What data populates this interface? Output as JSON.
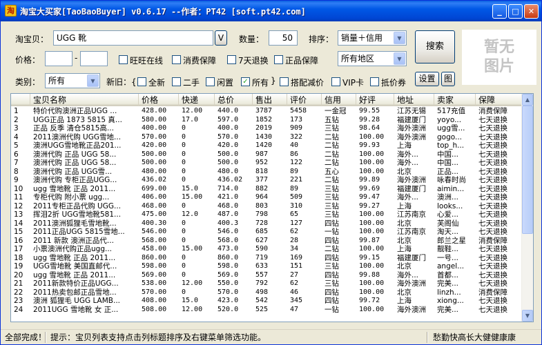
{
  "window": {
    "title": "淘宝大买家[TaoBaoBuyer] v0.6.17 --作者：PT42 [soft.pt42.com]",
    "app_icon": "淘",
    "minimize": "_",
    "maximize": "□",
    "close": "✕"
  },
  "search": {
    "keyword_label": "淘宝贝：",
    "keyword_value": "UGG 靴",
    "v_button": "V",
    "qty_label": "数量：",
    "qty_value": "50",
    "sort_label": "排序：",
    "sort_value": "销量＋信用",
    "price_label": "价格：",
    "price_sep": "-",
    "price_min": "",
    "price_max": "",
    "search_button": "搜索",
    "region_value": "所有地区",
    "category_label": "类别：",
    "category_value": "所有",
    "condition_label": "新旧：{",
    "condition_close": "}",
    "settings_button": "设置",
    "image_button": "图"
  },
  "options": {
    "wangwang": "旺旺在线",
    "consumer_protect": "消费保障",
    "seven_day": "7天退换",
    "genuine": "正品保障",
    "new": "全新",
    "second_hand": "二手",
    "idle": "闲置",
    "all": "所有",
    "bundle": "搭配减价",
    "vip": "VIP卡",
    "coupon": "抵价券"
  },
  "checked": {
    "all": "✓"
  },
  "preview": {
    "line1": "暂无",
    "line2": "图片"
  },
  "columns": [
    "",
    "宝贝名称",
    "价格",
    "快递",
    "总价",
    "售出",
    "评价",
    "信用",
    "好评",
    "地址",
    "卖家",
    "保障"
  ],
  "rows": [
    [
      "1",
      "特价代购澳洲正品UGG ...",
      "428.00",
      "12.00",
      "440.0",
      "3787",
      "5458",
      "一金冠",
      "99.55",
      "江苏无锡",
      "517充值",
      "消费保障"
    ],
    [
      "2",
      "UGG正品 1873 5815 真...",
      "580.00",
      "17.0",
      "597.0",
      "1852",
      "173",
      "五钻",
      "99.28",
      "福建厦门",
      "yoyo...",
      "七天退换"
    ],
    [
      "3",
      "正品 反季 清仓5815高...",
      "400.00",
      "0",
      "400.0",
      "2019",
      "909",
      "三钻",
      "98.64",
      "海外澳洲",
      "ugg雪...",
      "七天退换"
    ],
    [
      "4",
      "2011澳洲代购 UGG雪地...",
      "570.00",
      "0",
      "570.0",
      "1430",
      "322",
      "二钻",
      "100.00",
      "海外澳洲",
      "gogo...",
      "七天退换"
    ],
    [
      "5",
      "澳洲UGG雪地靴正品201...",
      "420.00",
      "0",
      "420.0",
      "1420",
      "40",
      "二钻",
      "99.93",
      "上海",
      "top_h...",
      "七天退换"
    ],
    [
      "6",
      "澳洲代购 正品 UGG 58...",
      "500.00",
      "0",
      "500.0",
      "987",
      "86",
      "二钻",
      "100.00",
      "海外...",
      "中国...",
      "七天退换"
    ],
    [
      "7",
      "澳洲代购 正品 UGG 58...",
      "500.00",
      "0",
      "500.0",
      "952",
      "122",
      "二钻",
      "100.00",
      "海外...",
      "中国...",
      "七天退换"
    ],
    [
      "8",
      "澳洲代购 正品 UGG雪...",
      "480.00",
      "0",
      "480.0",
      "818",
      "89",
      "五心",
      "100.00",
      "北京",
      "正品...",
      "七天退换"
    ],
    [
      "9",
      "澳洲代购 专柜正品UGG...",
      "436.02",
      "0",
      "436.02",
      "377",
      "221",
      "二钻",
      "99.89",
      "海外澳洲",
      "咏春时尚",
      "七天退换"
    ],
    [
      "10",
      "ugg 雪地靴 正品 2011...",
      "699.00",
      "15.0",
      "714.0",
      "882",
      "89",
      "三钻",
      "99.69",
      "福建厦门",
      "aimin...",
      "七天退换"
    ],
    [
      "11",
      "专柜代购 附小票 ugg...",
      "406.00",
      "15.00",
      "421.0",
      "964",
      "509",
      "三钻",
      "99.47",
      "海外...",
      "澳洲...",
      "七天退换"
    ],
    [
      "12",
      "2011专柜正品代购 UGG...",
      "468.00",
      "0",
      "468.0",
      "803",
      "310",
      "三钻",
      "99.27",
      "上海",
      "looks...",
      "七天退换"
    ],
    [
      "13",
      "挥泪2折 UGG雪地靴581...",
      "475.00",
      "12.0",
      "487.0",
      "798",
      "65",
      "三钻",
      "100.00",
      "江苏南京",
      "心爱...",
      "七天退换"
    ],
    [
      "14",
      "2011澳洲狐狸毛雪地靴...",
      "400.30",
      "0",
      "400.3",
      "728",
      "127",
      "四钻",
      "100.00",
      "北京",
      "芙阁仙",
      "七天退换"
    ],
    [
      "15",
      "2011正品UGG 5815雪地...",
      "546.00",
      "0",
      "546.0",
      "685",
      "62",
      "一钻",
      "100.00",
      "江苏南京",
      "淘天...",
      "七天退换"
    ],
    [
      "16",
      "2011 新款 澳洲正品代...",
      "568.00",
      "0",
      "568.0",
      "627",
      "28",
      "四钻",
      "99.87",
      "北京",
      "郎兰之星",
      "消费保障"
    ],
    [
      "17",
      "小票澳洲代购正品ugg...",
      "458.00",
      "15.00",
      "473.0",
      "590",
      "34",
      "二钻",
      "100.00",
      "上海",
      "靓鞋...",
      "七天退换"
    ],
    [
      "18",
      "ugg 雪地靴 正品 2011...",
      "860.00",
      "0",
      "860.0",
      "719",
      "169",
      "四钻",
      "99.15",
      "福建厦门",
      "一号...",
      "七天退换"
    ],
    [
      "19",
      "UGG雪地靴 美国直邮代...",
      "598.00",
      "0",
      "598.0",
      "633",
      "151",
      "三钻",
      "100.00",
      "北京",
      "angel...",
      "七天退换"
    ],
    [
      "20",
      "ugg 雪地靴 正品 2011...",
      "569.00",
      "0",
      "569.0",
      "557",
      "27",
      "四钻",
      "99.88",
      "海外...",
      "首都...",
      "七天退换"
    ],
    [
      "21",
      "2011新款特价正品UGG...",
      "538.00",
      "12.00",
      "550.0",
      "792",
      "62",
      "三钻",
      "100.00",
      "海外澳洲",
      "完美...",
      "七天退换"
    ],
    [
      "22",
      "2011热卖包邮正品雪地...",
      "570.00",
      "0",
      "570.0",
      "498",
      "46",
      "四钻",
      "100.00",
      "北京",
      "linzh...",
      "消费保障"
    ],
    [
      "23",
      "澳洲 狐狸毛 UGG LAMB...",
      "408.00",
      "15.0",
      "423.0",
      "542",
      "345",
      "四钻",
      "99.72",
      "上海",
      "xiong...",
      "七天退换"
    ],
    [
      "24",
      "2011UGG 雪地靴 女 正...",
      "508.00",
      "12.00",
      "520.0",
      "525",
      "47",
      "一钻",
      "100.00",
      "海外澳洲",
      "完美...",
      "七天退换"
    ]
  ],
  "status": {
    "left": "全部完成！",
    "middle": "提示：宝贝列表支持点击列标题排序及右键菜单筛选功能。",
    "right": "愁勤快高长大健健康康"
  },
  "scroll_position": 0
}
